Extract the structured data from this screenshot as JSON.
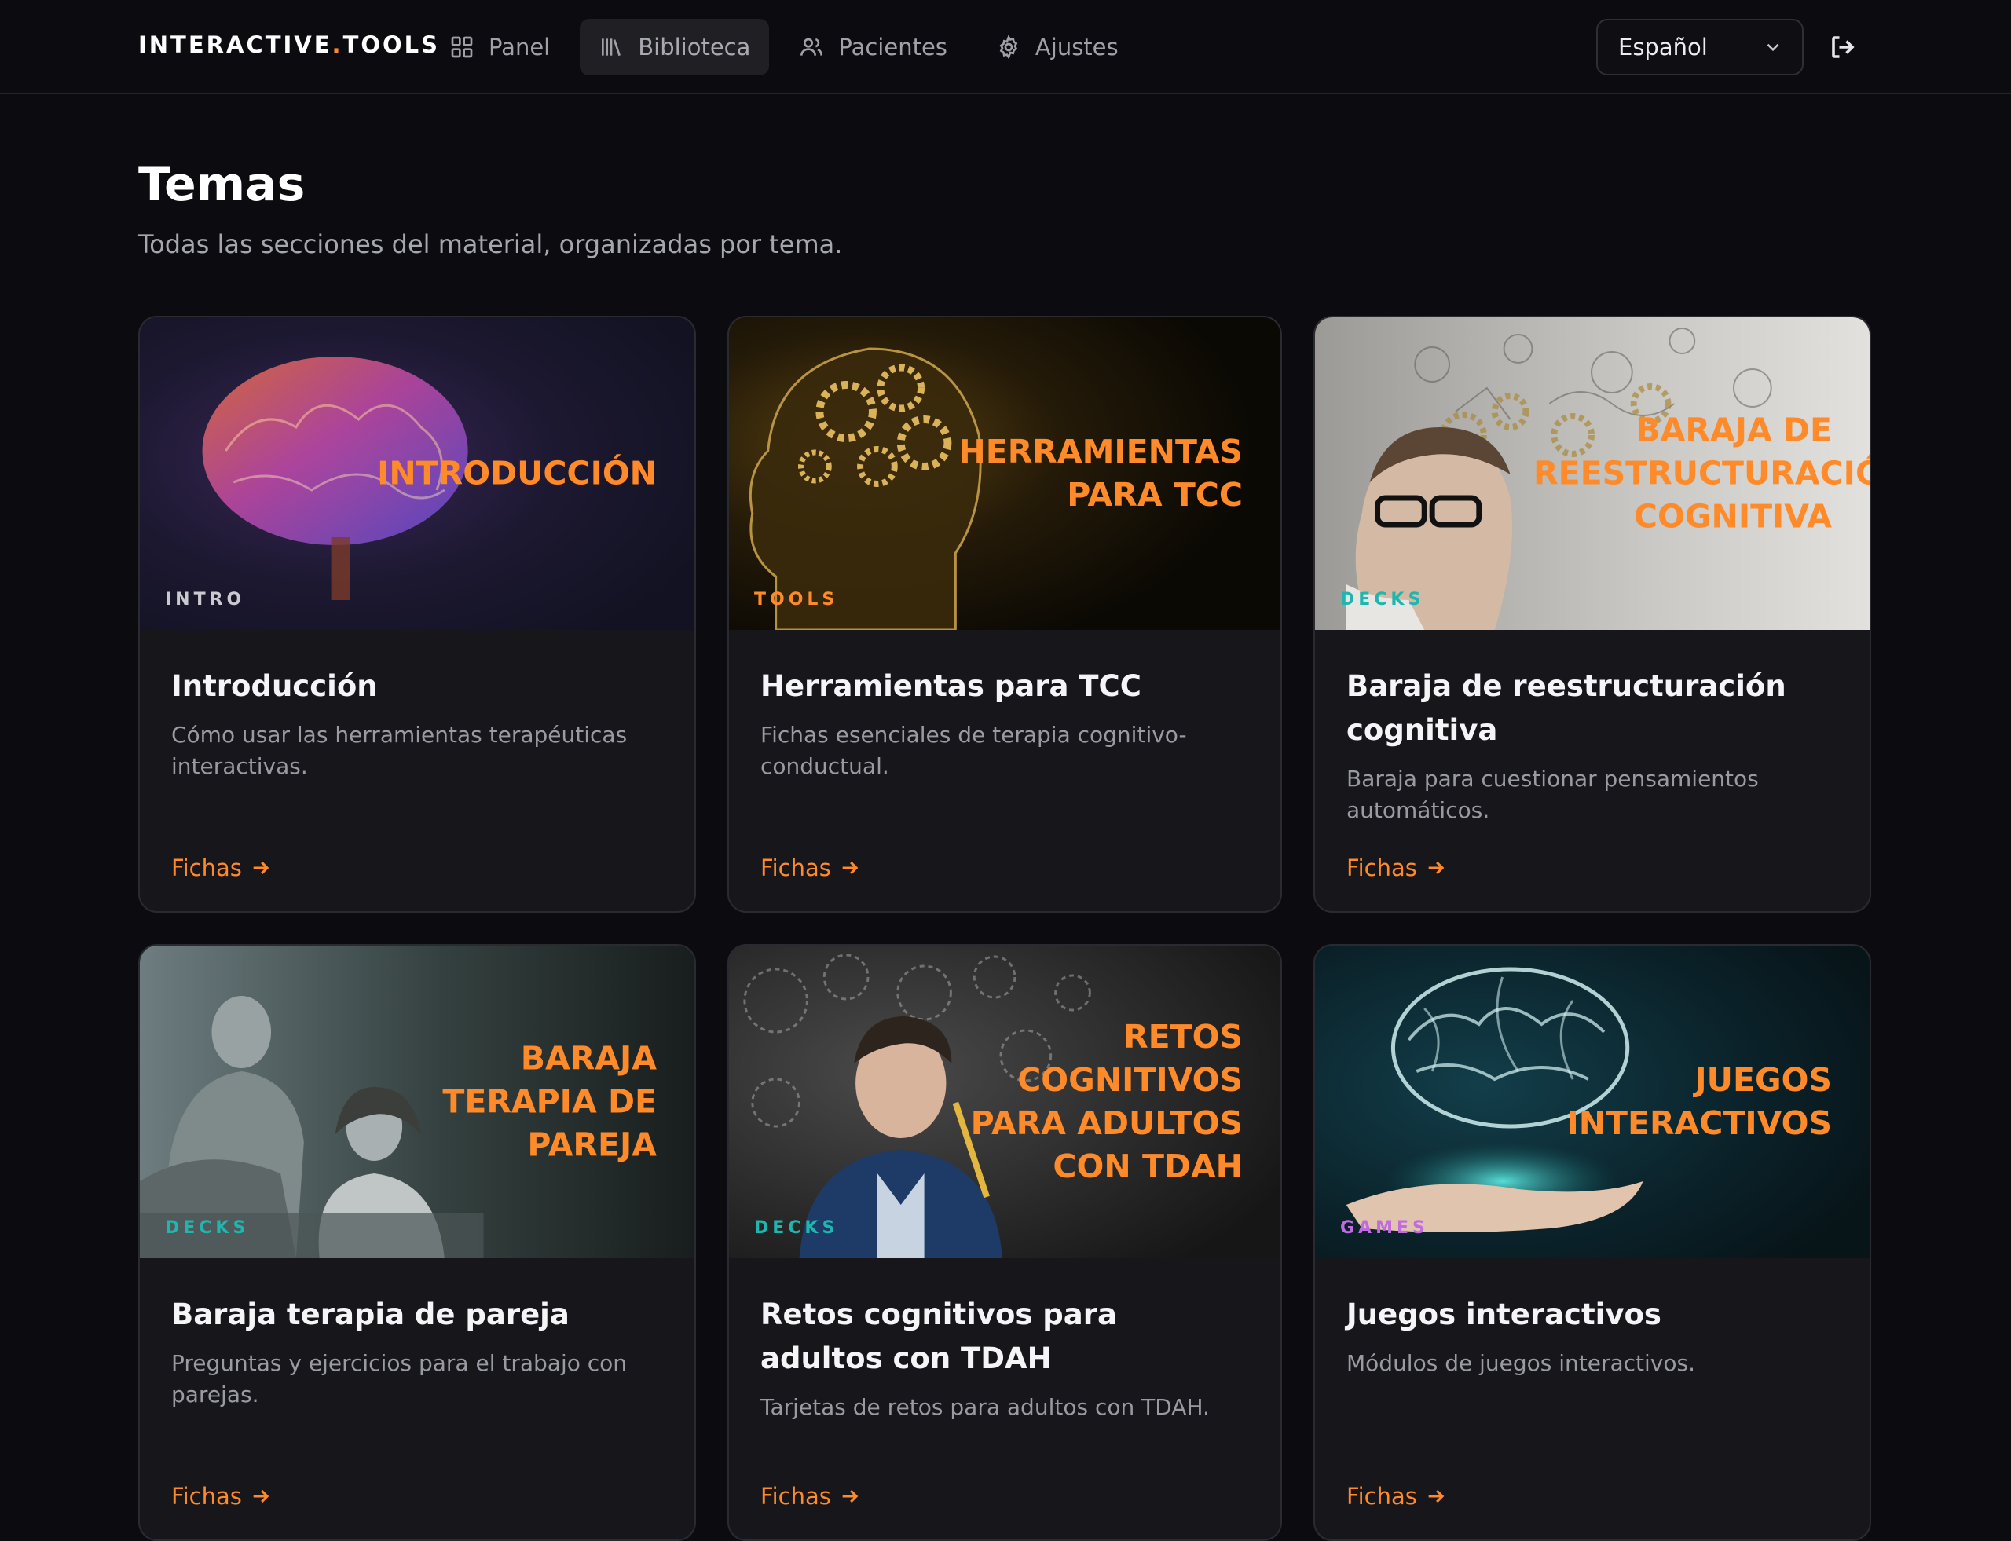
{
  "brand": {
    "left": "INTERACTIVE",
    "dot": ".",
    "right": "TOOLS"
  },
  "nav": {
    "items": [
      {
        "label": "Panel",
        "icon": "dashboard-grid-icon"
      },
      {
        "label": "Biblioteca",
        "icon": "library-icon"
      },
      {
        "label": "Pacientes",
        "icon": "users-icon"
      },
      {
        "label": "Ajustes",
        "icon": "gear-icon"
      }
    ],
    "active": "Biblioteca"
  },
  "language": {
    "selected": "Español"
  },
  "page": {
    "title": "Temas",
    "subtitle": "Todas las secciones del material, organizadas por tema."
  },
  "colors": {
    "accent": "#ff8a2a",
    "teal": "#1fb6b0",
    "purple": "#c06be0",
    "background": "#0c0c10"
  },
  "cards": [
    {
      "hero_title": "Introducción",
      "badge": "INTRO",
      "badge_color": "#c9c9cf",
      "title": "Introducción",
      "description": "Cómo usar las herramientas terapéuticas interactivas.",
      "link": "Fichas"
    },
    {
      "hero_title": "Herramientas para TCC",
      "badge": "TOOLS",
      "badge_color": "#ff8a2a",
      "title": "Herramientas para TCC",
      "description": "Fichas esenciales de terapia cognitivo-conductual.",
      "link": "Fichas"
    },
    {
      "hero_title": "Baraja de reestructuración cognitiva",
      "badge": "DECKS",
      "badge_color": "#1fb6b0",
      "title": "Baraja de reestructuración cognitiva",
      "description": "Baraja para cuestionar pensamientos automáticos.",
      "link": "Fichas"
    },
    {
      "hero_title": "Baraja terapia de pareja",
      "badge": "DECKS",
      "badge_color": "#1fb6b0",
      "title": "Baraja terapia de pareja",
      "description": "Preguntas y ejercicios para el trabajo con parejas.",
      "link": "Fichas"
    },
    {
      "hero_title": "Retos cognitivos para adultos con TDAH",
      "badge": "DECKS",
      "badge_color": "#1fb6b0",
      "title": "Retos cognitivos para adultos con TDAH",
      "description": "Tarjetas de retos para adultos con TDAH.",
      "link": "Fichas"
    },
    {
      "hero_title": "Juegos interactivos",
      "badge": "GAMES",
      "badge_color": "#c06be0",
      "title": "Juegos interactivos",
      "description": "Módulos de juegos interactivos.",
      "link": "Fichas"
    }
  ]
}
